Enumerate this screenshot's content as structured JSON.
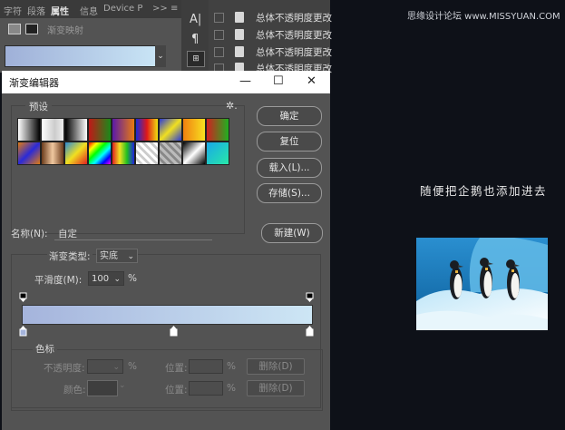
{
  "top_panel": {
    "tabs": [
      "字符",
      "段落",
      "属性",
      "信息",
      "Device P"
    ],
    "more": ">>",
    "subtitle": "渐变映射"
  },
  "history": {
    "items": [
      "总体不透明度更改",
      "总体不透明度更改",
      "总体不透明度更改",
      "总体不透明度更改"
    ]
  },
  "dialog": {
    "title": "渐变编辑器",
    "presets_label": "预设",
    "ok": "确定",
    "reset": "复位",
    "load": "载入(L)...",
    "save": "存储(S)...",
    "name_label": "名称(N):",
    "name_value": "自定",
    "new": "新建(W)",
    "gradient_type_label": "渐变类型:",
    "gradient_type_value": "实底",
    "smoothness_label": "平滑度(M):",
    "smoothness_value": "100",
    "percent": "%",
    "color_stops_label": "色标",
    "opacity_label": "不透明度:",
    "color_label": "颜色:",
    "location_label": "位置:",
    "delete": "删除(D)"
  },
  "colors": {
    "gradient_start": "#a5b4dc",
    "gradient_end": "#cde6f5"
  },
  "brand": "思缘设计论坛 www.MISSYUAN.COM",
  "caption": "随便把企鹅也添加进去"
}
